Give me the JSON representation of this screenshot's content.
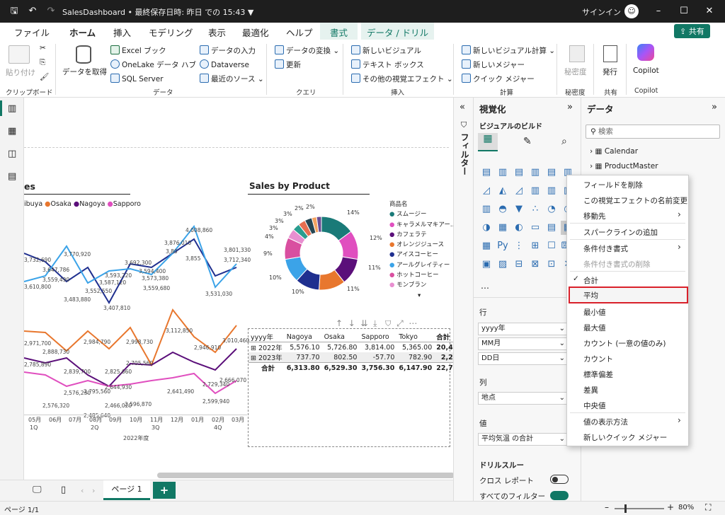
{
  "titlebar": {
    "filename": "SalesDashboard • 最終保存日時: 昨日 での 15:43 ▼",
    "signin": "サインイン"
  },
  "menu": {
    "tabs": [
      "ファイル",
      "ホーム",
      "挿入",
      "モデリング",
      "表示",
      "最適化",
      "ヘルプ",
      "書式",
      "データ / ドリル"
    ],
    "share": "共有"
  },
  "ribbon": {
    "paste": "貼り付け",
    "clipboard": "クリップボード",
    "getdata": "データを取得",
    "excel": "Excel ブック",
    "onelake": "OneLake データ ハブ",
    "sql": "SQL Server",
    "enterdata": "データの入力",
    "dataverse": "Dataverse",
    "recent": "最近のソース",
    "datagroup": "データ",
    "transform": "データの変換",
    "refresh": "更新",
    "querygroup": "クエリ",
    "newvisual": "新しいビジュアル",
    "textbox": "テキスト ボックス",
    "morevisuals": "その他の視覚エフェクト",
    "insertgroup": "挿入",
    "newcalc": "新しいビジュアル計算",
    "newmeasure": "新しいメジャー",
    "quickmeasure": "クイック メジャー",
    "calcgroup": "計算",
    "sensitivity": "秘密度",
    "sensitivitygroup": "秘密度",
    "publish": "発行",
    "sharegroup": "共有",
    "copilot": "Copilot",
    "copilotgroup": "Copilot"
  },
  "canvas": {
    "line_title_partial": "es",
    "line_legend": [
      "ibuya",
      "Osaka",
      "Nagoya",
      "Sapporo"
    ],
    "line_legend_colors": [
      "#1f4e79",
      "#e8772e",
      "#5b0f7a",
      "#e04fbf"
    ],
    "top_labels": [
      "3,732,690",
      "3,647,786",
      "3,610,800",
      "3,559,490",
      "3,483,880",
      "3,770,920",
      "3,552,550",
      "3,587,120",
      "3,593,220",
      "3,407,810",
      "3,692,300",
      "3,594,400",
      "3,573,380",
      "3,559,680",
      "3,876,010",
      "3,80",
      "3,855",
      "4,008,860",
      "3,801,330",
      "3,712,340",
      "3,531,030"
    ],
    "bottom_labels": [
      "2,971,700",
      "2,888,730",
      "2,785,890",
      "2,839,700",
      "2,984,790",
      "2,998,730",
      "2,705,560",
      "2,825,660",
      "2,795,560",
      "2,641,490",
      "2,644,930",
      "2,576,230",
      "2,576,320",
      "2,485,640",
      "2,466,020",
      "2,596,870",
      "2,729,340",
      "2,599,940",
      "2,666,070",
      "3,112,850",
      "2,946,910",
      "3,010,460"
    ],
    "x_months": [
      "05月",
      "06月",
      "07月",
      "08月",
      "09月",
      "10月",
      "11月",
      "12月",
      "01月",
      "02月",
      "03月"
    ],
    "x_quarters": [
      "1Q",
      "2Q",
      "3Q",
      "4Q"
    ],
    "x_year": "2022年度",
    "donut_title": "Sales by Product",
    "donut_legend_title": "商品名",
    "donut_pct": [
      "14%",
      "12%",
      "11%",
      "11%",
      "10%",
      "10%",
      "9%",
      "4%",
      "3%",
      "3%",
      "3%",
      "2%",
      "2%"
    ],
    "table": {
      "header": [
        "yyyy年",
        "Nagoya",
        "Osaka",
        "Sapporo",
        "Tokyo",
        "合計"
      ],
      "rows": [
        [
          "2022年",
          "5,576.10",
          "5,726.80",
          "3,814.00",
          "5,365.00",
          "20,481.90"
        ],
        [
          "2023年",
          "737.70",
          "802.50",
          "-57.70",
          "782.90",
          "2,265.40"
        ],
        [
          "合計",
          "6,313.80",
          "6,529.30",
          "3,756.30",
          "6,147.90",
          "22,747.30"
        ]
      ]
    }
  },
  "chart_data": [
    {
      "type": "pie",
      "title": "Sales by Product",
      "legend_title": "商品名",
      "categories": [
        "スムージー",
        "キャラメルマキアー...",
        "カフェラテ",
        "オレンジジュース",
        "アイスコーヒー",
        "アールグレイティー",
        "ホットコーヒー",
        "モンブラン"
      ],
      "colors": [
        "#1a7a78",
        "#e04fbf",
        "#5b0f7a",
        "#e8772e",
        "#1f2f8f",
        "#3ba3e8",
        "#d94fa0",
        "#e88fd0"
      ],
      "values": [
        14,
        12,
        11,
        11,
        10,
        10,
        9,
        4,
        3,
        3,
        3,
        2,
        2
      ]
    }
  ],
  "viz": {
    "title": "視覚化",
    "build": "ビジュアルのビルド",
    "rows_label": "行",
    "rows": [
      "yyyy年",
      "MM月",
      "DD日"
    ],
    "cols_label": "列",
    "cols": [
      "地点"
    ],
    "values_label": "値",
    "values": [
      "平均気温 の合計"
    ],
    "drill": "ドリルスルー",
    "cross": "クロス レポート",
    "allfilters": "すべてのフィルター"
  },
  "filter_label": "フィルター",
  "data": {
    "title": "データ",
    "search": "検索",
    "tables": [
      "Calendar",
      "ProductMaster"
    ]
  },
  "context_menu": {
    "items": [
      "フィールドを削除",
      "この視覚エフェクトの名前変更",
      "移動先",
      "スパークラインの追加",
      "条件付き書式",
      "条件付き書式の削除",
      "合計",
      "平均",
      "最小値",
      "最大値",
      "カウント (一意の値のみ)",
      "カウント",
      "標準偏差",
      "差異",
      "中央値",
      "値の表示方法",
      "新しいクイック メジャー"
    ],
    "checked": "合計",
    "highlighted": "平均"
  },
  "pages": {
    "page1": "ページ 1",
    "add": "+"
  },
  "status": {
    "page": "ページ 1/1",
    "zoom": "80%"
  }
}
